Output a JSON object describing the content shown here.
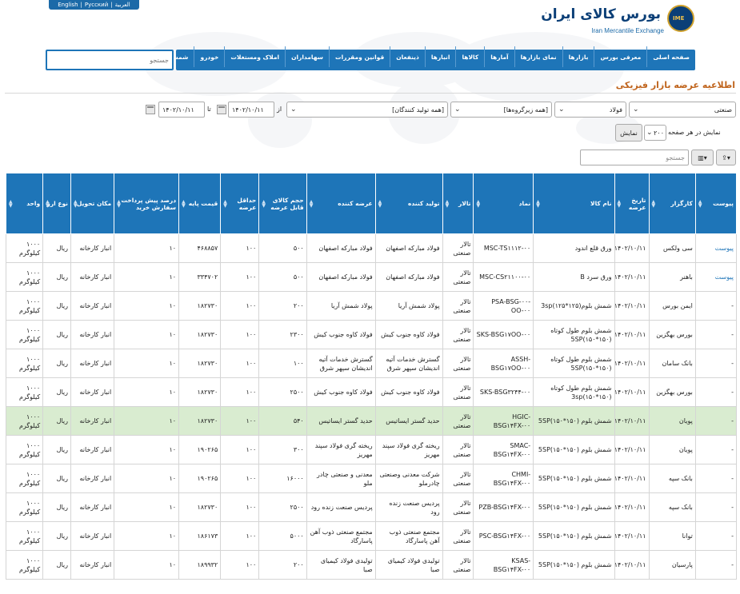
{
  "header": {
    "lang_links": [
      "English",
      "|",
      "Русский",
      "|",
      "العربية"
    ],
    "logo_fa": "بورس کالای ایران",
    "logo_en": "Iran Mercantile Exchange",
    "logo_mark": "IME"
  },
  "nav": {
    "items": [
      "صفحه اصلی",
      "معرفی بورس",
      "بازارها",
      "نمای بازارها",
      "آمارها",
      "کالاها",
      "انبارها",
      "ذینفعان",
      "قوانین ومقررات",
      "سهامداران",
      "املاک ومستغلات",
      "خودرو",
      "شمش طلا"
    ],
    "search_placeholder": "جستجو"
  },
  "page_title": "اطلاعیه عرضه بازار فیزیکی",
  "filters": {
    "market": "صنعتی",
    "group": "فولاد",
    "subgroup": "[همه زیرگروه‌ها]",
    "producer": "[همه تولید کنندگان]",
    "from_label": "از",
    "from_date": "۱۴۰۲/۱۰/۱۱",
    "to_label": "تا",
    "to_date": "۱۴۰۲/۱۰/۱۱",
    "per_page_label": "نمایش در هر صفحه",
    "per_page": "۲۰۰",
    "show_button": "نمایش",
    "grid_search_placeholder": "جستجو"
  },
  "table": {
    "headers": [
      "پیوست",
      "کارگزار",
      "تاریخ عرضه",
      "نام کالا",
      "نماد",
      "تالار",
      "تولید کننده",
      "عرضه کننده",
      "حجم کالای قابل عرضه",
      "حداقل عرضه",
      "قیمت پایه",
      "درصد پیش پرداخت سفارش خرید",
      "مکان تحویل",
      "نوع ارز",
      "واحد"
    ],
    "rows": [
      {
        "attach": "پیوست",
        "broker": "سی ولکس",
        "date": "۱۴۰۲/۱۰/۱۱",
        "name": "ورق قلع اندود",
        "symbol": "MSC-TS۱۱۱۲-۰۰",
        "hall": "تالار صنعتی",
        "producer": "فولاد مبارکه اصفهان",
        "supplier": "فولاد مبارکه اصفهان",
        "volume": "۵۰۰",
        "min": "۱۰۰",
        "price": "۴۶۸۸۵۷",
        "prepay": "۱۰",
        "place": "انبار کارخانه",
        "currency": "ریال",
        "unit": "۱۰۰۰ کیلوگرم",
        "hl": false
      },
      {
        "attach": "پیوست",
        "broker": "باهنر",
        "date": "۱۴۰۲/۱۰/۱۱",
        "name": "ورق سرد B",
        "symbol": "MSC-CS۲۱۱۰۰-۰۰",
        "hall": "تالار صنعتی",
        "producer": "فولاد مبارکه اصفهان",
        "supplier": "فولاد مبارکه اصفهان",
        "volume": "۵۰۰",
        "min": "۱۰۰",
        "price": "۳۳۴۷۰۲",
        "prepay": "۱۰",
        "place": "انبار کارخانه",
        "currency": "ریال",
        "unit": "۱۰۰۰ کیلوگرم",
        "hl": false
      },
      {
        "attach": "-",
        "broker": "ایمن بورس",
        "date": "۱۴۰۲/۱۰/۱۱",
        "name": "شمش بلوم(۱۲۵*۱۲۵)3sp",
        "symbol": "PSA-BSG-۰۰-OO-۰۰",
        "hall": "تالار صنعتی",
        "producer": "پولاد شمش آریا",
        "supplier": "پولاد شمش آریا",
        "volume": "۲۰۰",
        "min": "۱۰۰",
        "price": "۱۸۲۷۳۰",
        "prepay": "۱۰",
        "place": "انبار کارخانه",
        "currency": "ریال",
        "unit": "۱۰۰۰ کیلوگرم",
        "hl": false
      },
      {
        "attach": "-",
        "broker": "بورس بهگزین",
        "date": "۱۴۰۲/۱۰/۱۱",
        "name": "شمش بلوم طول کوتاه (۱۵۰*۱۵۰)5SP",
        "symbol": "SKS-BSG۱۷OO-۰۰",
        "hall": "تالار صنعتی",
        "producer": "فولاد کاوه جنوب کیش",
        "supplier": "فولاد کاوه جنوب کیش",
        "volume": "۲۳۰۰",
        "min": "۱۰۰",
        "price": "۱۸۲۷۳۰",
        "prepay": "۱۰",
        "place": "انبار کارخانه",
        "currency": "ریال",
        "unit": "۱۰۰۰ کیلوگرم",
        "hl": false
      },
      {
        "attach": "-",
        "broker": "بانک سامان",
        "date": "۱۴۰۲/۱۰/۱۱",
        "name": "شمش بلوم طول کوتاه (۱۵۰*۱۵۰)5SP",
        "symbol": "ASSH-BSG۱۷OO-۰۰",
        "hall": "تالار صنعتی",
        "producer": "گسترش خدمات آتیه اندیشان سپهر شرق",
        "supplier": "گسترش خدمات آتیه اندیشان سپهر شرق",
        "volume": "۱۰۰",
        "min": "۱۰۰",
        "price": "۱۸۲۷۳۰",
        "prepay": "۱۰",
        "place": "انبار کارخانه",
        "currency": "ریال",
        "unit": "۱۰۰۰ کیلوگرم",
        "hl": false
      },
      {
        "attach": "-",
        "broker": "بورس بهگزین",
        "date": "۱۴۰۲/۱۰/۱۱",
        "name": "شمش بلوم طول کوتاه (۱۵۰*۱۵۰)3sp",
        "symbol": "SKS-BSG۳۲۴۴-۰۰",
        "hall": "تالار صنعتی",
        "producer": "فولاد کاوه جنوب کیش",
        "supplier": "فولاد کاوه جنوب کیش",
        "volume": "۲۵۰۰",
        "min": "۱۰۰",
        "price": "۱۸۲۷۳۰",
        "prepay": "۱۰",
        "place": "انبار کارخانه",
        "currency": "ریال",
        "unit": "۱۰۰۰ کیلوگرم",
        "hl": false
      },
      {
        "attach": "-",
        "broker": "پویان",
        "date": "۱۴۰۲/۱۰/۱۱",
        "name": "شمش بلوم (۱۵۰*۱۵۰)5SP",
        "symbol": "HGIC-BSG۱۴FX-۰۰",
        "hall": "تالار صنعتی",
        "producer": "حدید گستر ایساتیس",
        "supplier": "حدید گستر ایساتیس",
        "volume": "۵۴۰",
        "min": "۱۰۰",
        "price": "۱۸۲۷۳۰",
        "prepay": "۱۰",
        "place": "انبار کارخانه",
        "currency": "ریال",
        "unit": "۱۰۰۰ کیلوگرم",
        "hl": true
      },
      {
        "attach": "-",
        "broker": "پویان",
        "date": "۱۴۰۲/۱۰/۱۱",
        "name": "شمش بلوم (۱۵۰*۱۵۰)5SP",
        "symbol": "SMAC-BSG۱۴FX-۰۰",
        "hall": "تالار صنعتی",
        "producer": "ریخته گری فولاد سپند مهریز",
        "supplier": "ریخته گری فولاد سپند مهریز",
        "volume": "۳۰۰",
        "min": "۱۰۰",
        "price": "۱۹۰۲۶۵",
        "prepay": "۱۰",
        "place": "انبار کارخانه",
        "currency": "ریال",
        "unit": "۱۰۰۰ کیلوگرم",
        "hl": false
      },
      {
        "attach": "-",
        "broker": "بانک سپه",
        "date": "۱۴۰۲/۱۰/۱۱",
        "name": "شمش بلوم (۱۵۰*۱۵۰)5SP",
        "symbol": "CHMI-BSG۱۴FX-۰۰",
        "hall": "تالار صنعتی",
        "producer": "شرکت معدنی وصنعتی چادرملو",
        "supplier": "معدنی و صنعتی چادر ملو",
        "volume": "۱۶۰۰۰",
        "min": "۱۰۰",
        "price": "۱۹۰۲۶۵",
        "prepay": "۱۰",
        "place": "انبار کارخانه",
        "currency": "ریال",
        "unit": "۱۰۰۰ کیلوگرم",
        "hl": false
      },
      {
        "attach": "-",
        "broker": "بانک سپه",
        "date": "۱۴۰۲/۱۰/۱۱",
        "name": "شمش بلوم (۱۵۰*۱۵۰)5SP",
        "symbol": "PZB-BSG۱۴FX-۰۰",
        "hall": "تالار صنعتی",
        "producer": "پردیس صنعت زنده رود",
        "supplier": "پردیس صنعت زنده رود",
        "volume": "۲۵۰۰",
        "min": "۱۰۰",
        "price": "۱۸۲۷۳۰",
        "prepay": "۱۰",
        "place": "انبار کارخانه",
        "currency": "ریال",
        "unit": "۱۰۰۰ کیلوگرم",
        "hl": false
      },
      {
        "attach": "-",
        "broker": "توانا",
        "date": "۱۴۰۲/۱۰/۱۱",
        "name": "شمش بلوم (۱۵۰*۱۵۰)5SP",
        "symbol": "PSC-BSG۱۴FX-۰۰",
        "hall": "تالار صنعتی",
        "producer": "مجتمع صنعتی ذوب آهن پاسارگاد",
        "supplier": "مجتمع صنعتی ذوب آهن پاسارگاد",
        "volume": "۵۰۰۰",
        "min": "۱۰۰",
        "price": "۱۸۶۱۷۳",
        "prepay": "۱۰",
        "place": "انبار کارخانه",
        "currency": "ریال",
        "unit": "۱۰۰۰ کیلوگرم",
        "hl": false
      },
      {
        "attach": "-",
        "broker": "پارسیان",
        "date": "۱۴۰۲/۱۰/۱۱",
        "name": "شمش بلوم (۱۵۰*۱۵۰)5SP",
        "symbol": "KSAS-BSG۱۴FX-۰۰",
        "hall": "تالار صنعتی",
        "producer": "تولیدی فولاد کیمیای صبا",
        "supplier": "تولیدی فولاد کیمیای صبا",
        "volume": "۲۰۰",
        "min": "۱۰۰",
        "price": "۱۸۹۹۳۲",
        "prepay": "۱۰",
        "place": "انبار کارخانه",
        "currency": "ریال",
        "unit": "۱۰۰۰ کیلوگرم",
        "hl": false
      }
    ]
  }
}
